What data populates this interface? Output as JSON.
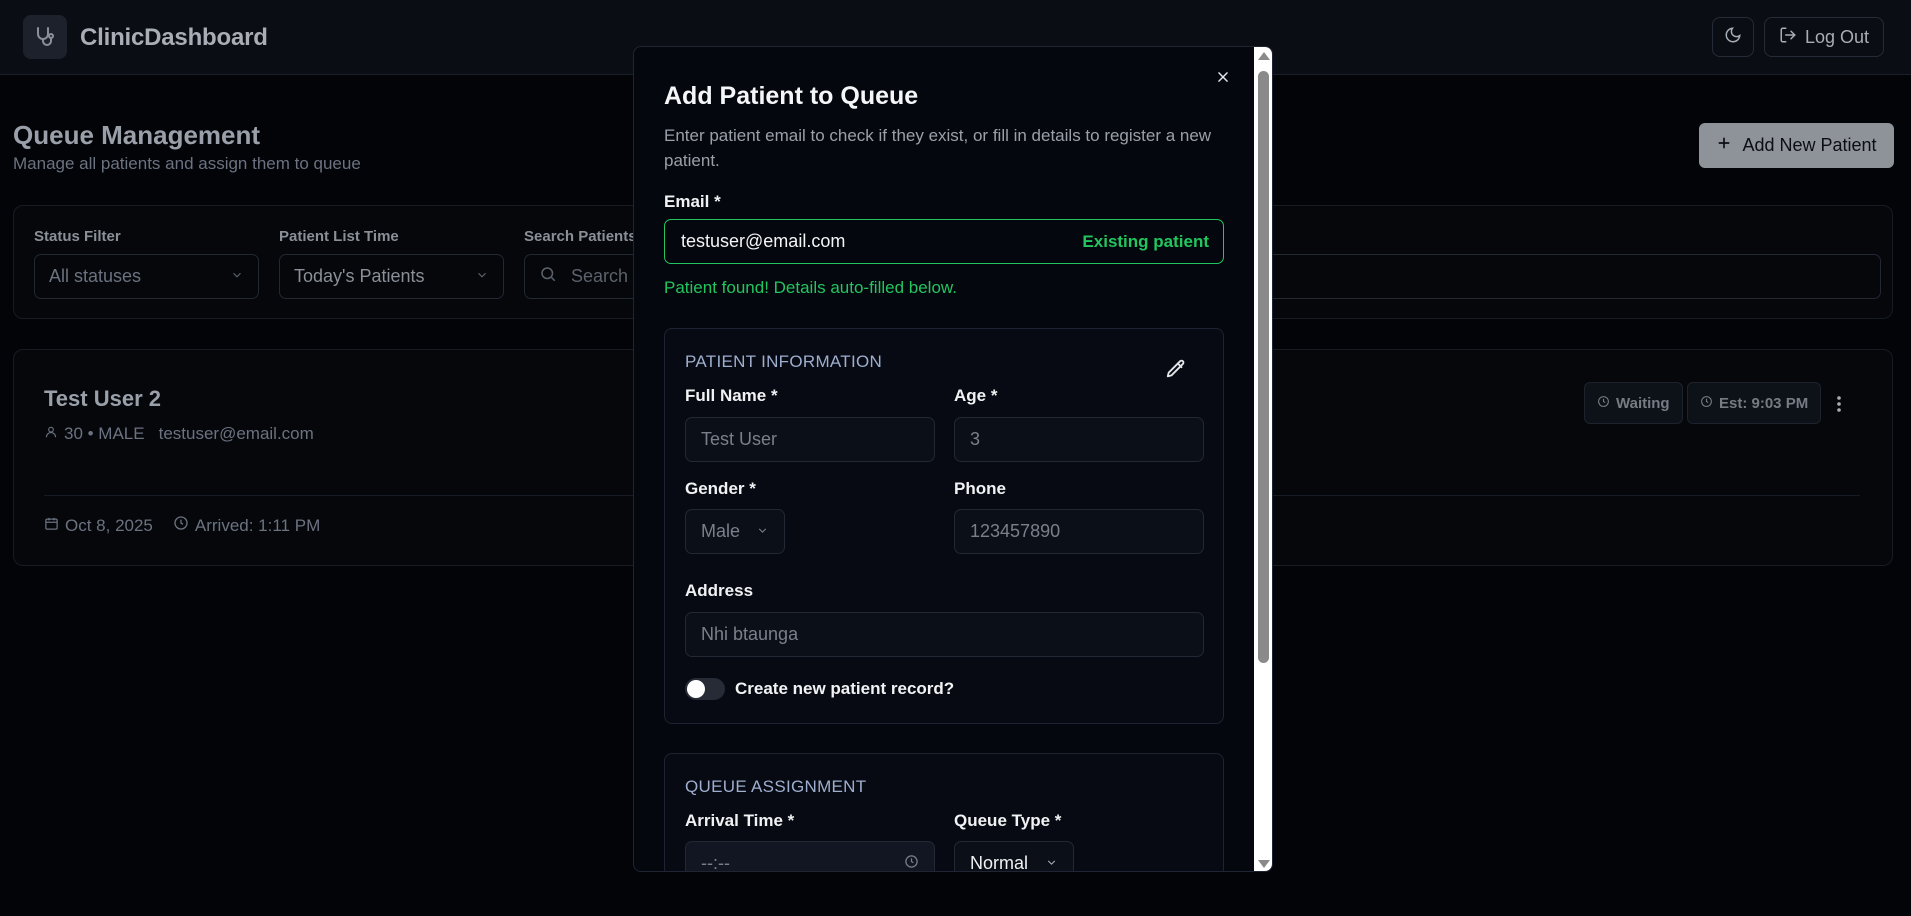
{
  "app": {
    "title": "ClinicDashboard",
    "logout_label": "Log Out"
  },
  "page": {
    "title": "Queue Management",
    "subtitle": "Manage all patients and assign them to queue",
    "add_button": "Add New Patient"
  },
  "filters": {
    "status_label": "Status Filter",
    "status_value": "All statuses",
    "time_label": "Patient List Time",
    "time_value": "Today's Patients",
    "search_label": "Search Patients",
    "search_placeholder": "Search"
  },
  "patient_card": {
    "name": "Test User 2",
    "age_gender": "30 • MALE",
    "email": "testuser@email.com",
    "date": "Oct 8, 2025",
    "arrived": "Arrived: 1:11 PM",
    "status": "Waiting",
    "estimate": "Est: 9:03 PM"
  },
  "modal": {
    "title": "Add Patient to Queue",
    "description": "Enter patient email to check if they exist, or fill in details to register a new patient.",
    "email_label": "Email *",
    "email_value": "testuser@email.com",
    "email_tag": "Existing patient",
    "found_message": "Patient found! Details auto-filled below.",
    "patient_info": {
      "title": "PATIENT INFORMATION",
      "full_name_label": "Full Name *",
      "full_name_value": "Test User",
      "age_label": "Age *",
      "age_value": "3",
      "gender_label": "Gender *",
      "gender_value": "Male",
      "phone_label": "Phone",
      "phone_value": "123457890",
      "address_label": "Address",
      "address_value": "Nhi btaunga",
      "create_record_label": "Create new patient record?"
    },
    "queue_assignment": {
      "title": "QUEUE ASSIGNMENT",
      "arrival_label": "Arrival Time *",
      "arrival_value": "--:--",
      "queue_type_label": "Queue Type *",
      "queue_type_value": "Normal"
    }
  },
  "colors": {
    "success": "#22c55e",
    "background": "#020408",
    "section_title": "#9eaecf"
  },
  "icons": [
    "stethoscope-icon",
    "moon-icon",
    "logout-icon",
    "plus-icon",
    "chevron-down-icon",
    "search-icon",
    "user-icon",
    "calendar-icon",
    "clock-icon",
    "more-vertical-icon",
    "close-icon",
    "pencil-icon"
  ]
}
